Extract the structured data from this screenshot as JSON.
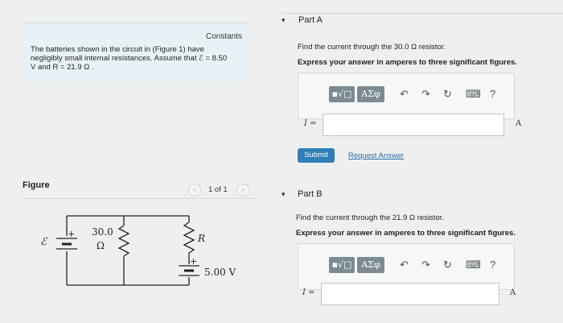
{
  "problem": {
    "constants_label": "Constants",
    "intro_line1": "The batteries shown in the circuit in (Figure 1) have",
    "intro_line2": "negligibly small internal resistances. Assume that ℰ = 8.50",
    "intro_line3": "V and R = 21.9 Ω ."
  },
  "figure": {
    "title": "Figure",
    "pager_text": "1 of 1",
    "prev_arrow": "<",
    "next_arrow": ">",
    "circuit": {
      "emf_label": "ℰ",
      "plus_left": "+",
      "resistor1_value": "30.0",
      "resistor1_unit": "Ω",
      "resistor2_label": "R",
      "plus_right": "+",
      "battery2_label": "5.00 V"
    }
  },
  "partA": {
    "caret": "▾",
    "title": "Part A",
    "question": "Find the current through the 30.0 Ω resistor.",
    "instruction": "Express your answer in amperes to three significant figures.",
    "toolbar": {
      "template_btn": "▪√□",
      "greek_btn": "ΑΣφ",
      "undo_icon": "↶",
      "redo_icon": "↷",
      "reset_icon": "↻",
      "keyboard_icon": "⌨",
      "help_icon": "?"
    },
    "answer_label": "I =",
    "answer_value": "",
    "unit": "A",
    "submit_label": "Submit",
    "request_label": "Request Answer"
  },
  "partB": {
    "caret": "▾",
    "title": "Part B",
    "question": "Find the current through the 21.9 Ω resistor.",
    "instruction": "Express your answer in amperes to three significant figures.",
    "toolbar": {
      "template_btn": "▪√□",
      "greek_btn": "ΑΣφ",
      "undo_icon": "↶",
      "redo_icon": "↷",
      "reset_icon": "↻",
      "keyboard_icon": "⌨",
      "help_icon": "?"
    },
    "answer_label": "I =",
    "answer_value": "",
    "unit": "A"
  }
}
